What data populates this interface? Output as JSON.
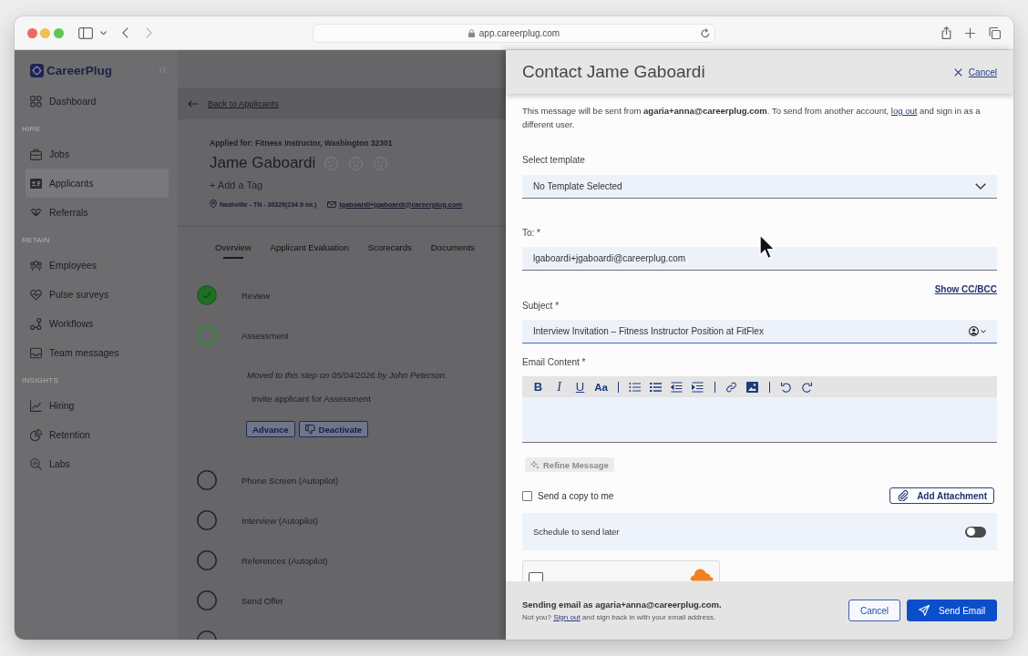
{
  "browser": {
    "url": "app.careerplug.com"
  },
  "sidebar": {
    "brand": "CareerPlug",
    "sections": [
      {
        "items": [
          {
            "label": "Dashboard",
            "selected": false
          }
        ]
      },
      {
        "heading": "HIRE",
        "items": [
          {
            "label": "Jobs",
            "selected": false
          },
          {
            "label": "Applicants",
            "selected": true
          },
          {
            "label": "Referrals",
            "selected": false
          }
        ]
      },
      {
        "heading": "RETAIN",
        "items": [
          {
            "label": "Employees",
            "selected": false
          },
          {
            "label": "Pulse surveys",
            "selected": false
          },
          {
            "label": "Workflows",
            "selected": false
          },
          {
            "label": "Team messages",
            "selected": false
          }
        ]
      },
      {
        "heading": "INSIGHTS",
        "items": [
          {
            "label": "Hiring",
            "selected": false
          },
          {
            "label": "Retention",
            "selected": false
          },
          {
            "label": "Labs",
            "selected": false
          }
        ]
      }
    ]
  },
  "applicant": {
    "back_link": "Back to Applicants",
    "applied_for": "Applied for: Fitness Instructor, Washington 32301",
    "name": "Jame Gaboardi",
    "add_tag": "+ Add a Tag",
    "location": "Nashville - TN - 30329(234.9 mi.)",
    "email": "lgaboardi+jgaboardi@careerplug.com"
  },
  "tabs": [
    {
      "label": "Overview",
      "selected": true
    },
    {
      "label": "Applicant Evaluation",
      "selected": false
    },
    {
      "label": "Scorecards",
      "selected": false
    },
    {
      "label": "Documents",
      "selected": false
    }
  ],
  "steps": [
    {
      "label": "Review",
      "completed": true,
      "active": false
    },
    {
      "label": "Assessment",
      "completed": false,
      "active": true,
      "note": "Moved to this step on 05/04/2026 by John Peterson.",
      "task": "Invite applicant for Assessment",
      "actions": [
        {
          "label": "Advance",
          "kind": "plain"
        },
        {
          "label": "Deactivate",
          "kind": "dismiss"
        }
      ]
    },
    {
      "label": "Phone Screen (Autopilot)",
      "completed": false,
      "active": false
    },
    {
      "label": "Interview (Autopilot)",
      "completed": false,
      "active": false
    },
    {
      "label": "References (Autopilot)",
      "completed": false,
      "active": false
    },
    {
      "label": "Send Offer",
      "completed": false,
      "active": false
    },
    {
      "completed": false,
      "active": false
    }
  ],
  "dialog": {
    "title": "Contact Jame Gaboardi",
    "cancel_link": "Cancel",
    "notice": {
      "text": "This message will be sent from **agaria+anna@careerplug.com**. To send from another account, ",
      "link": "log out",
      "rest": " and sign in as a different user."
    },
    "template": {
      "label": "Select template",
      "value": "No Template Selected"
    },
    "to": {
      "label": "To: *",
      "value": "lgaboardi+jgaboardi@careerplug.com",
      "focused": false
    },
    "cc_link": "Show CC/BCC",
    "subject": {
      "label": "Subject *",
      "value": "Interview Invitation – Fitness Instructor Position at FitFlex",
      "focused": true
    },
    "content": {
      "label": "Email Content *",
      "format_buttons": [
        "B",
        "I",
        "U",
        "Aa"
      ]
    },
    "refine_button": {
      "label": "Refine Message",
      "disabled": true
    },
    "copy_to_me": {
      "label": "Send a copy to me",
      "checked": false
    },
    "attachment_button": "Add Attachment",
    "schedule": {
      "label": "Schedule to send later",
      "on": false
    },
    "captcha": {
      "checked": false
    },
    "footer": {
      "sender": "Sending email as agaria+anna@careerplug.com.",
      "hint": "Not you? ",
      "hint_link": "Sign out",
      "hint_rest": " and sign back in with your email address.",
      "buttons": [
        {
          "label": "Cancel",
          "kind": "secondary"
        },
        {
          "label": "Send Email",
          "kind": "primary"
        }
      ]
    }
  }
}
